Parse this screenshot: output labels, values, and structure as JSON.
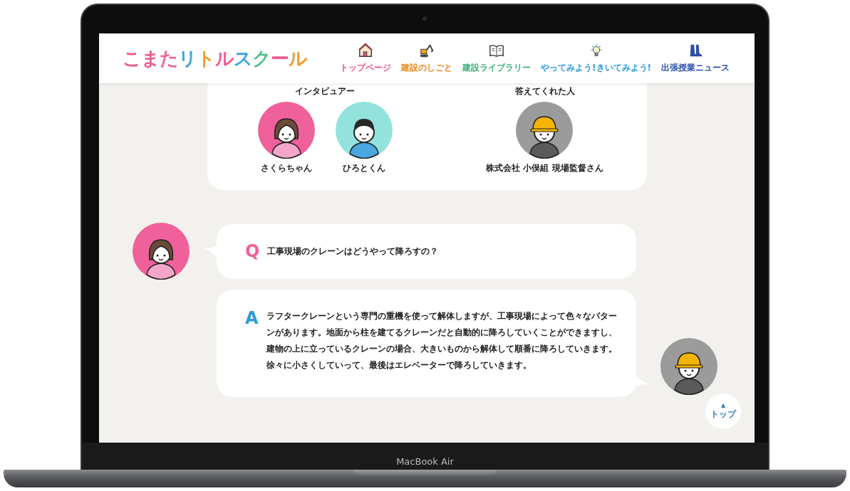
{
  "device_label": "MacBook Air",
  "logo": "こまたリトルスクール",
  "nav": [
    {
      "label": "トップページ",
      "kind": "house",
      "color": "#e8507f"
    },
    {
      "label": "建設のしごと",
      "kind": "excavator",
      "color": "#e8891e"
    },
    {
      "label": "建設ライブラリー",
      "kind": "book",
      "color": "#3fae7d"
    },
    {
      "label": "やってみよう!きいてみよう!",
      "kind": "bulb",
      "color": "#2b9bd6"
    },
    {
      "label": "出張授業ニュース",
      "kind": "boots",
      "color": "#2b4fa8"
    }
  ],
  "profile_card": {
    "groups": [
      {
        "heading": "インタビュアー",
        "people": [
          {
            "name": "さくらちゃん",
            "kind": "girl",
            "color": "#f0609a"
          },
          {
            "name": "ひろとくん",
            "kind": "boy",
            "color": "#93e2dd"
          }
        ]
      },
      {
        "heading": "答えてくれた人",
        "people": [
          {
            "name": "株式会社 小俣組 現場監督さん",
            "kind": "worker",
            "color": "#9b9b9b"
          }
        ]
      }
    ]
  },
  "dialogue": [
    {
      "kind": "question",
      "mark": "Q",
      "text": "工事現場のクレーンはどうやって降ろすの？",
      "speaker": {
        "kind": "girl",
        "color": "#f0609a"
      }
    },
    {
      "kind": "answer",
      "mark": "A",
      "text": "ラフタークレーンという専門の重機を使って解体しますが、工事現場によって色々なパターンがあります。地面から柱を建てるクレーンだと自動的に降ろしていくことができますし、建物の上に立っているクレーンの場合、大きいものから解体して順番に降ろしていきます。徐々に小さくしていって、最後はエレベーターで降ろしていきます。",
      "speaker": {
        "kind": "worker",
        "color": "#9b9b9b"
      }
    }
  ],
  "top_button": {
    "arrow": "▲",
    "label": "トップ"
  }
}
